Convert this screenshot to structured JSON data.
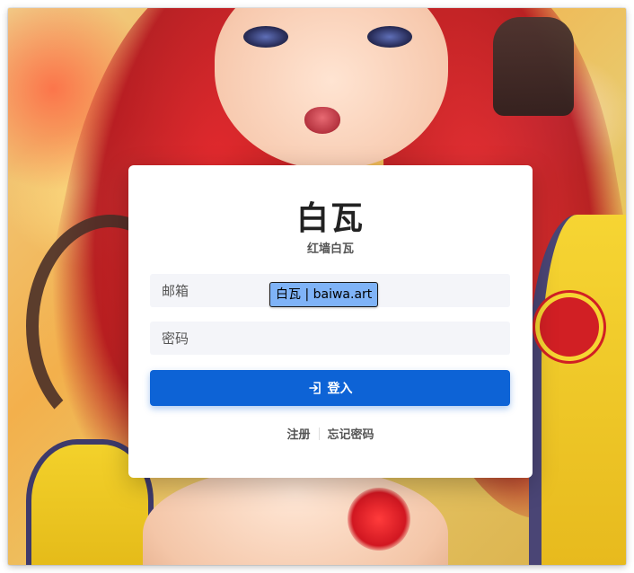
{
  "background": {
    "description_icon": "anime-illustration-background"
  },
  "card": {
    "title": "白瓦",
    "subtitle": "红墙白瓦"
  },
  "form": {
    "email_placeholder": "邮箱",
    "email_value": "",
    "password_placeholder": "密码",
    "password_value": "",
    "login_label": "登入",
    "login_icon": "login-enter-icon"
  },
  "tooltip": {
    "text": "白瓦 | baiwa.art"
  },
  "links": {
    "register": "注册",
    "forgot_password": "忘记密码"
  },
  "colors": {
    "primary": "#0d63d6",
    "input_bg": "#f4f5f9",
    "title": "#222222",
    "tooltip_bg": "#7fb3f7"
  }
}
